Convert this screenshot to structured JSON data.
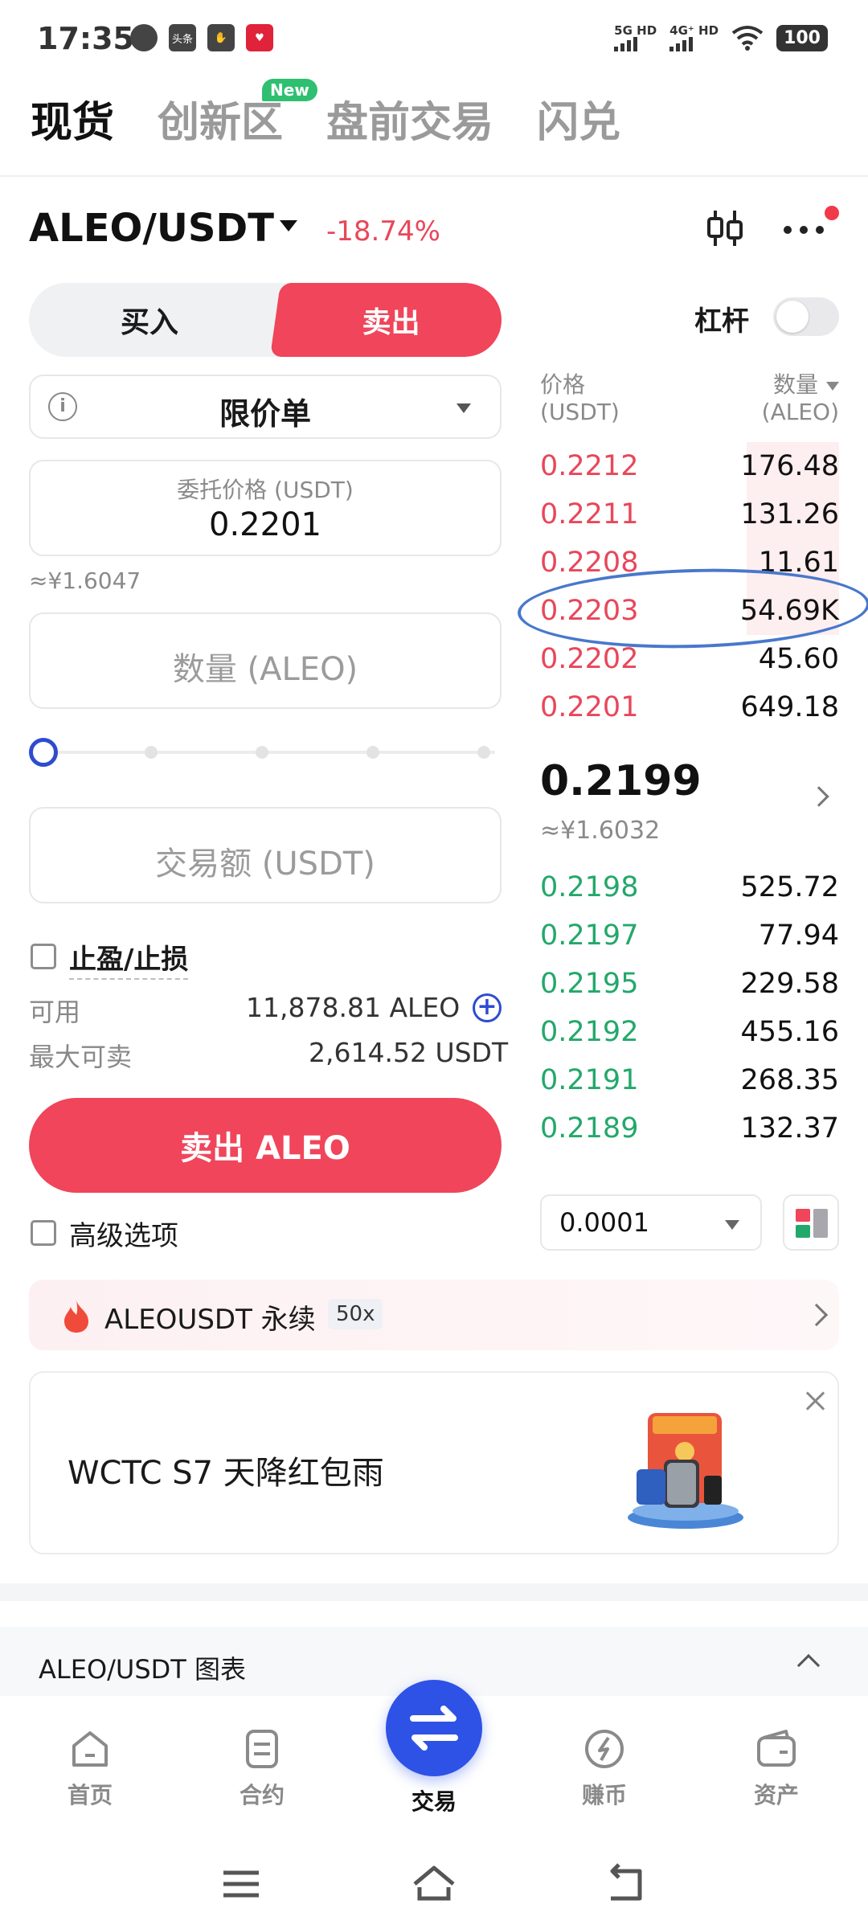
{
  "status_bar": {
    "time": "17:35",
    "notification_icons": [
      "chat-bubble-icon",
      "toutiao-icon",
      "hand-icon",
      "app-red-icon"
    ],
    "net1": "5G HD",
    "net2": "4G⁺ HD",
    "battery": "100"
  },
  "top_tabs": [
    {
      "label": "现货",
      "active": true
    },
    {
      "label": "创新区",
      "badge": "New"
    },
    {
      "label": "盘前交易"
    },
    {
      "label": "闪兑"
    }
  ],
  "pair": {
    "name": "ALEO/USDT",
    "change": "-18.74%",
    "change_color": "#e8475a"
  },
  "trade_side": {
    "buy_label": "买入",
    "sell_label": "卖出",
    "leverage_label": "杠杆",
    "leverage_enabled": false
  },
  "order_form": {
    "order_type": "限价单",
    "price_label": "委托价格 (USDT)",
    "price_value": "0.2201",
    "price_cny": "≈¥1.6047",
    "qty_placeholder": "数量 (ALEO)",
    "slider_percent": 0,
    "amount_placeholder": "交易额 (USDT)",
    "tpsl_label": "止盈/止损",
    "available_label": "可用",
    "available_value": "11,878.81 ALEO",
    "max_sell_label": "最大可卖",
    "max_sell_value": "2,614.52 USDT",
    "submit_label": "卖出 ALEO",
    "advanced_label": "高级选项"
  },
  "orderbook": {
    "price_header_1": "价格",
    "price_header_2": "(USDT)",
    "qty_header_1": "数量",
    "qty_header_2": "(ALEO)",
    "asks": [
      {
        "price": "0.2212",
        "qty": "176.48",
        "depth": 0.31
      },
      {
        "price": "0.2211",
        "qty": "131.26",
        "depth": 0.31
      },
      {
        "price": "0.2208",
        "qty": "11.61",
        "depth": 0.31
      },
      {
        "price": "0.2203",
        "qty": "54.69K",
        "depth": 0.31
      },
      {
        "price": "0.2202",
        "qty": "45.60",
        "depth": 0
      },
      {
        "price": "0.2201",
        "qty": "649.18",
        "depth": 0
      }
    ],
    "last_price": "0.2199",
    "last_price_cny": "≈¥1.6032",
    "bids": [
      {
        "price": "0.2198",
        "qty": "525.72"
      },
      {
        "price": "0.2197",
        "qty": "77.94"
      },
      {
        "price": "0.2195",
        "qty": "229.58"
      },
      {
        "price": "0.2192",
        "qty": "455.16"
      },
      {
        "price": "0.2191",
        "qty": "268.35"
      },
      {
        "price": "0.2189",
        "qty": "132.37"
      }
    ],
    "precision": "0.0001",
    "ask_color": "#e8475a",
    "bid_color": "#23a86b"
  },
  "perpetual_banner": {
    "label": "ALEOUSDT 永续",
    "leverage_badge": "50x"
  },
  "promo": {
    "text": "WCTC S7 天降红包雨"
  },
  "chart_section": {
    "label": "ALEO/USDT 图表"
  },
  "bottom_nav": [
    {
      "label": "首页",
      "icon": "home-icon"
    },
    {
      "label": "合约",
      "icon": "contract-icon"
    },
    {
      "label": "交易",
      "icon": "swap-icon",
      "active": true
    },
    {
      "label": "赚币",
      "icon": "earn-icon"
    },
    {
      "label": "资产",
      "icon": "wallet-icon"
    }
  ],
  "colors": {
    "accent_blue": "#2e52e6",
    "sell_red": "#f0455a"
  }
}
